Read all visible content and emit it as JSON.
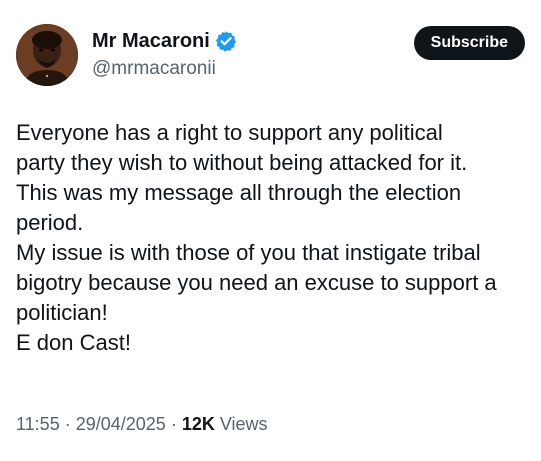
{
  "author": {
    "display_name": "Mr Macaroni",
    "handle": "@mrmacaronii",
    "verified": true,
    "verified_color": "#1d9bf0"
  },
  "actions": {
    "subscribe_label": "Subscribe"
  },
  "tweet": {
    "lines": [
      "Everyone has a right to support any political",
      "party they wish to without being attacked for it.",
      "This was my message all through the election",
      "period.",
      "My issue is with those of you that instigate tribal",
      "bigotry because you need an excuse to support a",
      "politician!",
      "E don Cast!"
    ]
  },
  "meta": {
    "time": "11:55",
    "separator": " · ",
    "date": "29/04/2025",
    "views_count": "12K",
    "views_label": " Views"
  },
  "colors": {
    "text_primary": "#0f1419",
    "text_secondary": "#536471",
    "button_bg": "#0f1419"
  }
}
